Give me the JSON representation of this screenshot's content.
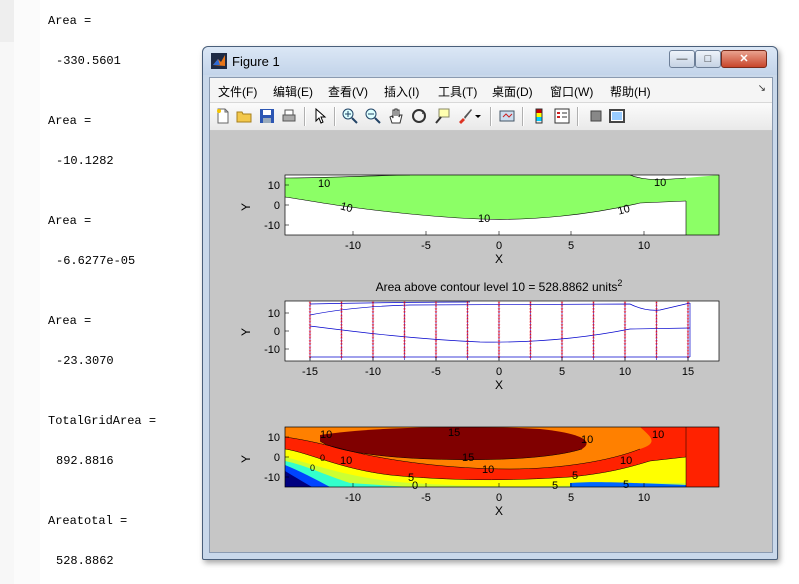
{
  "command_window": {
    "lines": [
      {
        "label": "Area =",
        "value": "-330.5601"
      },
      {
        "label": "Area =",
        "value": "-10.1282"
      },
      {
        "label": "Area =",
        "value": "-6.6277e-05"
      },
      {
        "label": "Area =",
        "value": "-23.3070"
      },
      {
        "label": "TotalGridArea =",
        "value": "892.8816"
      },
      {
        "label": "Areatotal =",
        "value": "528.8862"
      }
    ]
  },
  "figure": {
    "window_title": "Figure 1",
    "controls": {
      "minimize": "—",
      "maximize": "□",
      "close": "✕"
    },
    "menu": [
      "文件(F)",
      "编辑(E)",
      "查看(V)",
      "插入(I)",
      "工具(T)",
      "桌面(D)",
      "窗口(W)",
      "帮助(H)"
    ],
    "menu_pin": "↘",
    "toolbar_icons": [
      "new-file-icon",
      "open-folder-icon",
      "save-icon",
      "print-icon",
      "pointer-icon",
      "zoom-in-icon",
      "zoom-out-icon",
      "pan-hand-icon",
      "rotate-3d-icon",
      "data-cursor-icon",
      "brush-icon",
      "brush-dropdown-icon",
      "link-plot-icon",
      "colorbar-icon",
      "legend-icon",
      "hide-plot-tools-icon",
      "show-plot-tools-icon"
    ]
  },
  "plots": {
    "top": {
      "xlabel": "X",
      "ylabel": "Y",
      "xticks": [
        "-10",
        "-5",
        "0",
        "5",
        "10"
      ],
      "yticks": [
        "10",
        "0",
        "-10"
      ],
      "contour_labels": [
        "10",
        "10",
        "10",
        "10",
        "10"
      ],
      "fill_color": "#8cff66"
    },
    "middle": {
      "title": "Area above contour level 10 = 528.8862 units",
      "title_sup": "2",
      "xlabel": "X",
      "ylabel": "Y",
      "xticks": [
        "-15",
        "-10",
        "-5",
        "0",
        "5",
        "10",
        "15"
      ],
      "yticks": [
        "10",
        "0",
        "-10"
      ],
      "grid_x": [
        -15,
        -12.5,
        -10,
        -7.5,
        -5,
        -2.5,
        0,
        2.5,
        5,
        7.5,
        10,
        12.5,
        15
      ],
      "marker_color": "#ff0000",
      "line_color": "#0000cc"
    },
    "bottom": {
      "xlabel": "X",
      "ylabel": "Y",
      "xticks": [
        "-10",
        "-5",
        "0",
        "5",
        "10"
      ],
      "yticks": [
        "10",
        "0",
        "-10"
      ],
      "contour_labels": [
        "15",
        "10",
        "15",
        "10",
        "10",
        "10",
        "5",
        "5",
        "5",
        "5",
        "0",
        "0",
        "0",
        "10",
        "10"
      ]
    }
  }
}
